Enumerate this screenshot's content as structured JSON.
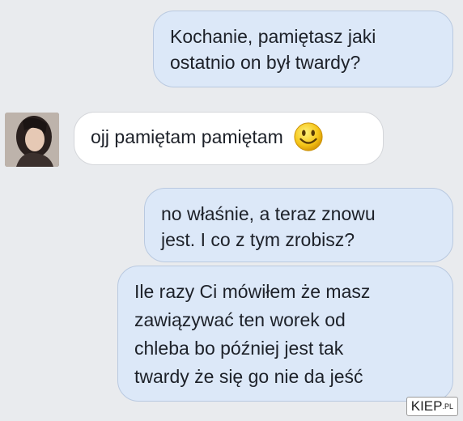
{
  "messages": [
    {
      "direction": "outgoing",
      "lines": [
        "Kochanie, pamiętasz jaki",
        "ostatnio on był twardy?"
      ]
    },
    {
      "direction": "incoming",
      "text": "ojj pamiętam pamiętam",
      "emoji": "smiley-icon"
    },
    {
      "direction": "outgoing",
      "lines": [
        "no właśnie, a teraz znowu",
        "jest. I co z tym zrobisz?"
      ]
    },
    {
      "direction": "outgoing",
      "lines": [
        "Ile razy Ci mówiłem że masz",
        "zawiązywać ten worek od",
        "chleba bo później jest tak",
        "twardy że się go nie da jeść"
      ]
    }
  ],
  "avatar": {
    "icon": "profile-photo"
  },
  "watermark": {
    "main": "KIEP",
    "suffix": ".PL"
  },
  "colors": {
    "outgoing_bubble": "#dce8f8",
    "incoming_bubble": "#ffffff",
    "background": "#e9ebee"
  }
}
